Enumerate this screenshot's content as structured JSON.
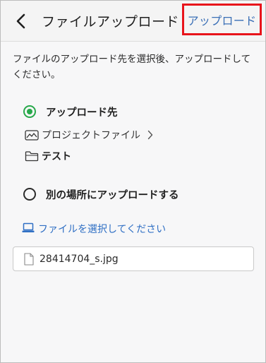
{
  "header": {
    "title": "ファイルアップロード",
    "upload_label": "アップロード",
    "back_icon": "chevron-left-icon"
  },
  "description": "ファイルのアップロード先を選択後、アップロードしてください。",
  "destination": {
    "default_option_label": "アップロード先",
    "default_selected": true,
    "breadcrumb_label": "プロジェクトファイル",
    "breadcrumb_icon": "project-drive-icon",
    "folder_label": "テスト",
    "folder_icon": "folder-icon",
    "other_option_label": "別の場所にアップロードする",
    "other_selected": false
  },
  "file_select": {
    "label": "ファイルを選択してください",
    "icon": "laptop-icon"
  },
  "selected_file": {
    "name": "28414704_s.jpg",
    "icon": "file-icon"
  },
  "colors": {
    "accent_green": "#27a84a",
    "link_blue": "#2f6fc4",
    "highlight_red": "#e8141b"
  }
}
